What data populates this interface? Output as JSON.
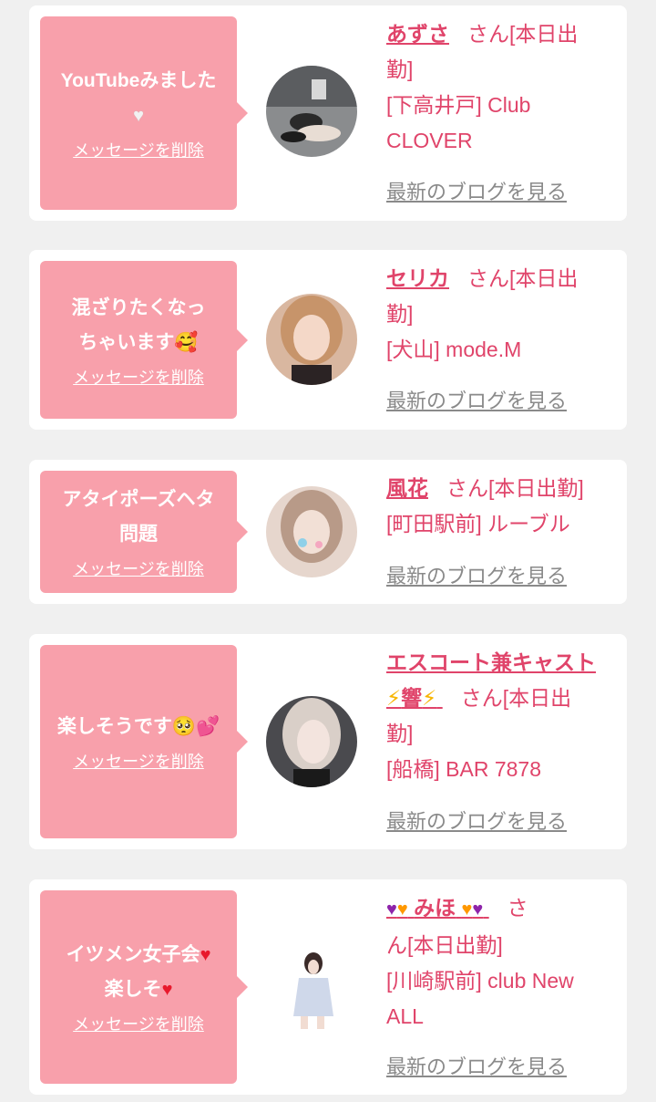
{
  "messages": [
    {
      "text": "YouTubeみました",
      "emoji": "♥",
      "delete_label": "メッセージを削除",
      "name": "あずさ",
      "honorific": "さん[本日出",
      "honorific_cont": "勤]",
      "shop": "[下高井戸] Club CLOVER",
      "blog_label": "最新のブログを見る"
    },
    {
      "text": "混ざりたくなっちゃいます",
      "emoji": "🥰",
      "delete_label": "メッセージを削除",
      "name": "セリカ",
      "honorific": "さん[本日出",
      "honorific_cont": "勤]",
      "shop": "[犬山] mode.M",
      "blog_label": "最新のブログを見る"
    },
    {
      "text": "アタイポーズヘタ問題",
      "delete_label": "メッセージを削除",
      "name": "風花",
      "honorific": "さん[本日出勤]",
      "shop": "[町田駅前] ルーブル",
      "blog_label": "最新のブログを見る"
    },
    {
      "text": "楽しそうです",
      "emoji": "🥺💕",
      "delete_label": "メッセージを削除",
      "name": "エスコート兼キャスト",
      "name_line2": "響",
      "bolt": "⚡",
      "honorific": "さん[本日出",
      "honorific_cont": "勤]",
      "shop": "[船橋] BAR 7878",
      "blog_label": "最新のブログを見る"
    },
    {
      "text_line1": "イツメン女子会",
      "text_line2": "楽しそ",
      "heart": "♥",
      "delete_label": "メッセージを削除",
      "name": "みほ",
      "name_heart_outer": "♥",
      "name_heart_inner": "♥",
      "honorific": "さ",
      "honorific_cont": "ん[本日出勤]",
      "shop": "[川崎駅前] club New ALL",
      "blog_label": "最新のブログを見る"
    }
  ],
  "colors": {
    "page_bg": "#f0f0f0",
    "bubble": "#f8a0ab",
    "name": "#e0446a",
    "blog_link": "#8a8a8a"
  }
}
